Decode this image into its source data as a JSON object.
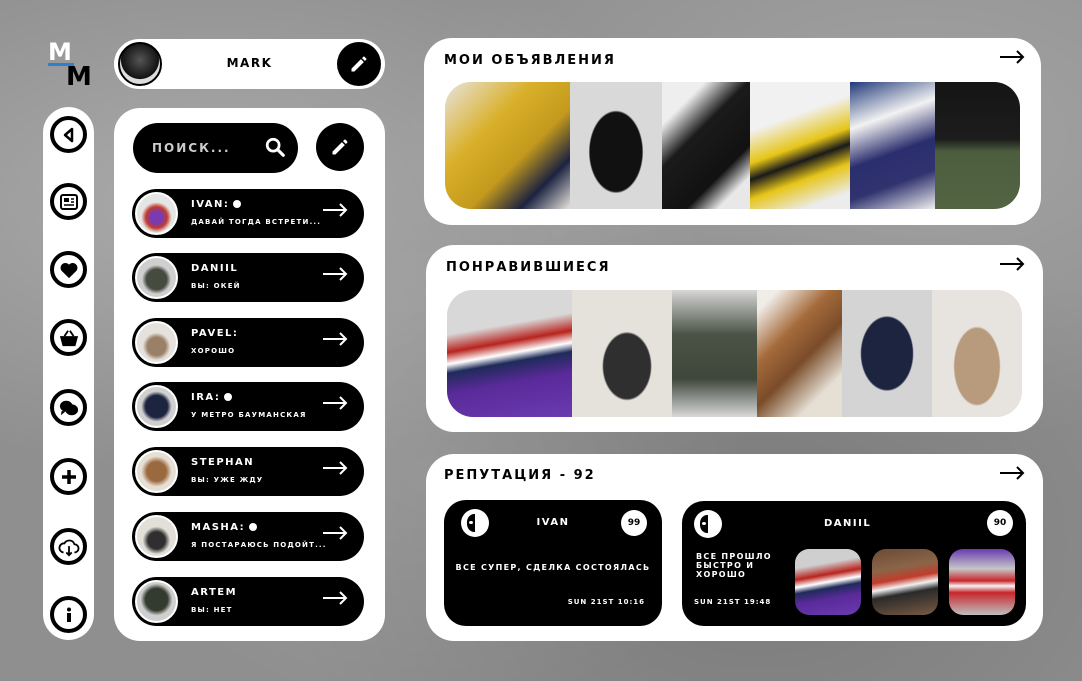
{
  "logo": {
    "letter_top": "M",
    "letter_bottom": "M"
  },
  "profile": {
    "name": "MARK"
  },
  "search": {
    "placeholder": "ПОИСК..."
  },
  "chats": [
    {
      "name": "IVAN:",
      "online": true,
      "message": "ДАВАЙ ТОГДА ВСТРЕТИ..."
    },
    {
      "name": "DANIIL",
      "online": false,
      "message": "ВЫ: ОКЕЙ"
    },
    {
      "name": "PAVEL:",
      "online": false,
      "message": "ХОРОШО"
    },
    {
      "name": "IRA:",
      "online": true,
      "message": "У МЕТРО БАУМАНСКАЯ"
    },
    {
      "name": "STEPHAN",
      "online": false,
      "message": "ВЫ: УЖЕ ЖДУ"
    },
    {
      "name": "MASHA:",
      "online": true,
      "message": "Я ПОСТАРАЮСЬ ПОДОЙТ..."
    },
    {
      "name": "ARTEM",
      "online": false,
      "message": "ВЫ: НЕТ"
    }
  ],
  "sections": {
    "listings": {
      "title": "МОИ ОБЪЯВЛЕНИЯ"
    },
    "liked": {
      "title": "ПОНРАВИВШИЕСЯ"
    },
    "reputation": {
      "title": "РЕПУТАЦИЯ  -  92"
    }
  },
  "reviews": [
    {
      "name": "IVAN",
      "score": "99",
      "text": "ВСЕ СУПЕР, СДЕЛКА СОСТОЯЛАСЬ",
      "date": "SUN 21ST 10:16"
    },
    {
      "name": "DANIIL",
      "score": "90",
      "text": "ВСЕ ПРОШЛО БЫСТРО И ХОРОШО",
      "date": "SUN 21ST 19:48"
    }
  ],
  "colors": {
    "accent_blue": "#2f7fd0",
    "black": "#000000",
    "white": "#ffffff"
  }
}
